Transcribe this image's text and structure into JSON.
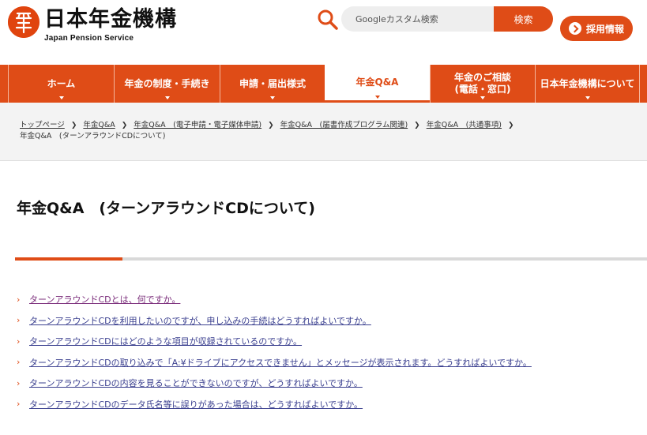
{
  "colors": {
    "accent": "#df4c17",
    "link": "#3a3f8f",
    "visited_link": "#7a2c7a"
  },
  "header": {
    "logo_title": "日本年金機構",
    "logo_subtitle": "Japan Pension Service",
    "search_placeholder": "Googleカスタム検索",
    "search_button": "検索",
    "recruit_button": "採用情報"
  },
  "nav": {
    "items": [
      {
        "label": "ホーム"
      },
      {
        "label": "年金の制度・手続き"
      },
      {
        "label": "申請・届出様式"
      },
      {
        "label": "年金Q&A",
        "active": true
      },
      {
        "label_line1": "年金のご相談",
        "label_line2": "(電話・窓口)"
      },
      {
        "label": "日本年金機構について"
      }
    ]
  },
  "breadcrumb": {
    "items": [
      "トップページ",
      "年金Q&A",
      "年金Q&A　(電子申請・電子媒体申請)",
      "年金Q&A　(届書作成プログラム関連)",
      "年金Q&A　(共通事項)"
    ],
    "current": "年金Q&A　(ターンアラウンドCDについて)"
  },
  "page": {
    "title": "年金Q&A　(ターンアラウンドCDについて)"
  },
  "questions": [
    "ターンアラウンドCDとは、何ですか。",
    "ターンアラウンドCDを利用したいのですが、申し込みの手続はどうすればよいですか。",
    "ターンアラウンドCDにはどのような項目が収録されているのですか。",
    "ターンアラウンドCDの取り込みで「A:¥ドライブにアクセスできません」とメッセージが表示されます。どうすればよいですか。",
    "ターンアラウンドCDの内容を見ることができないのですが、どうすればよいですか。",
    "ターンアラウンドCDのデータ氏名等に誤りがあった場合は、どうすればよいですか。"
  ]
}
